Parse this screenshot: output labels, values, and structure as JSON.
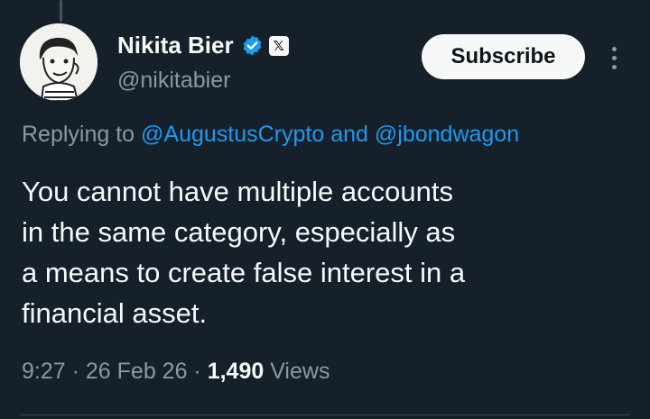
{
  "author": {
    "name": "Nikita Bier",
    "handle": "@nikitabier",
    "verified_icon": "verified-badge-icon",
    "affiliate_icon": "x-logo-icon",
    "affiliate_glyph": "𝕏"
  },
  "actions": {
    "subscribe_label": "Subscribe",
    "more_icon": "more-options-icon"
  },
  "reply": {
    "prefix": "Replying to ",
    "mention1": "@AugustusCrypto",
    "conjunction": " and ",
    "mention2": "@jbondwagon"
  },
  "tweet": {
    "lines": [
      "You cannot have multiple accounts",
      "in the same category, especially as",
      "a means to create false interest in a",
      "financial asset."
    ]
  },
  "meta": {
    "time": "9:27",
    "sep1": " · ",
    "date": "26 Feb 26",
    "sep2": " · ",
    "views_count": "1,490",
    "views_label": " Views"
  },
  "colors": {
    "background": "#15202b",
    "link": "#1d9bf0",
    "secondary_text": "#8b98a5",
    "verified": "#1d9bf0"
  }
}
